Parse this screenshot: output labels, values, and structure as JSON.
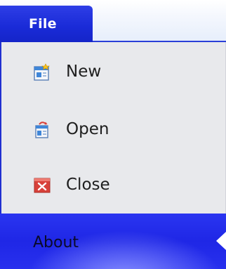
{
  "ribbon": {
    "file_tab_label": "File"
  },
  "menu": {
    "items": [
      {
        "label": "New",
        "icon": "new-document-icon"
      },
      {
        "label": "Open",
        "icon": "open-document-icon"
      },
      {
        "label": "Close",
        "icon": "close-icon"
      }
    ],
    "about_label": "About"
  },
  "colors": {
    "accent": "#1a2bd8",
    "menu_background": "#e8e9ec",
    "close_icon_red": "#d8413a"
  }
}
